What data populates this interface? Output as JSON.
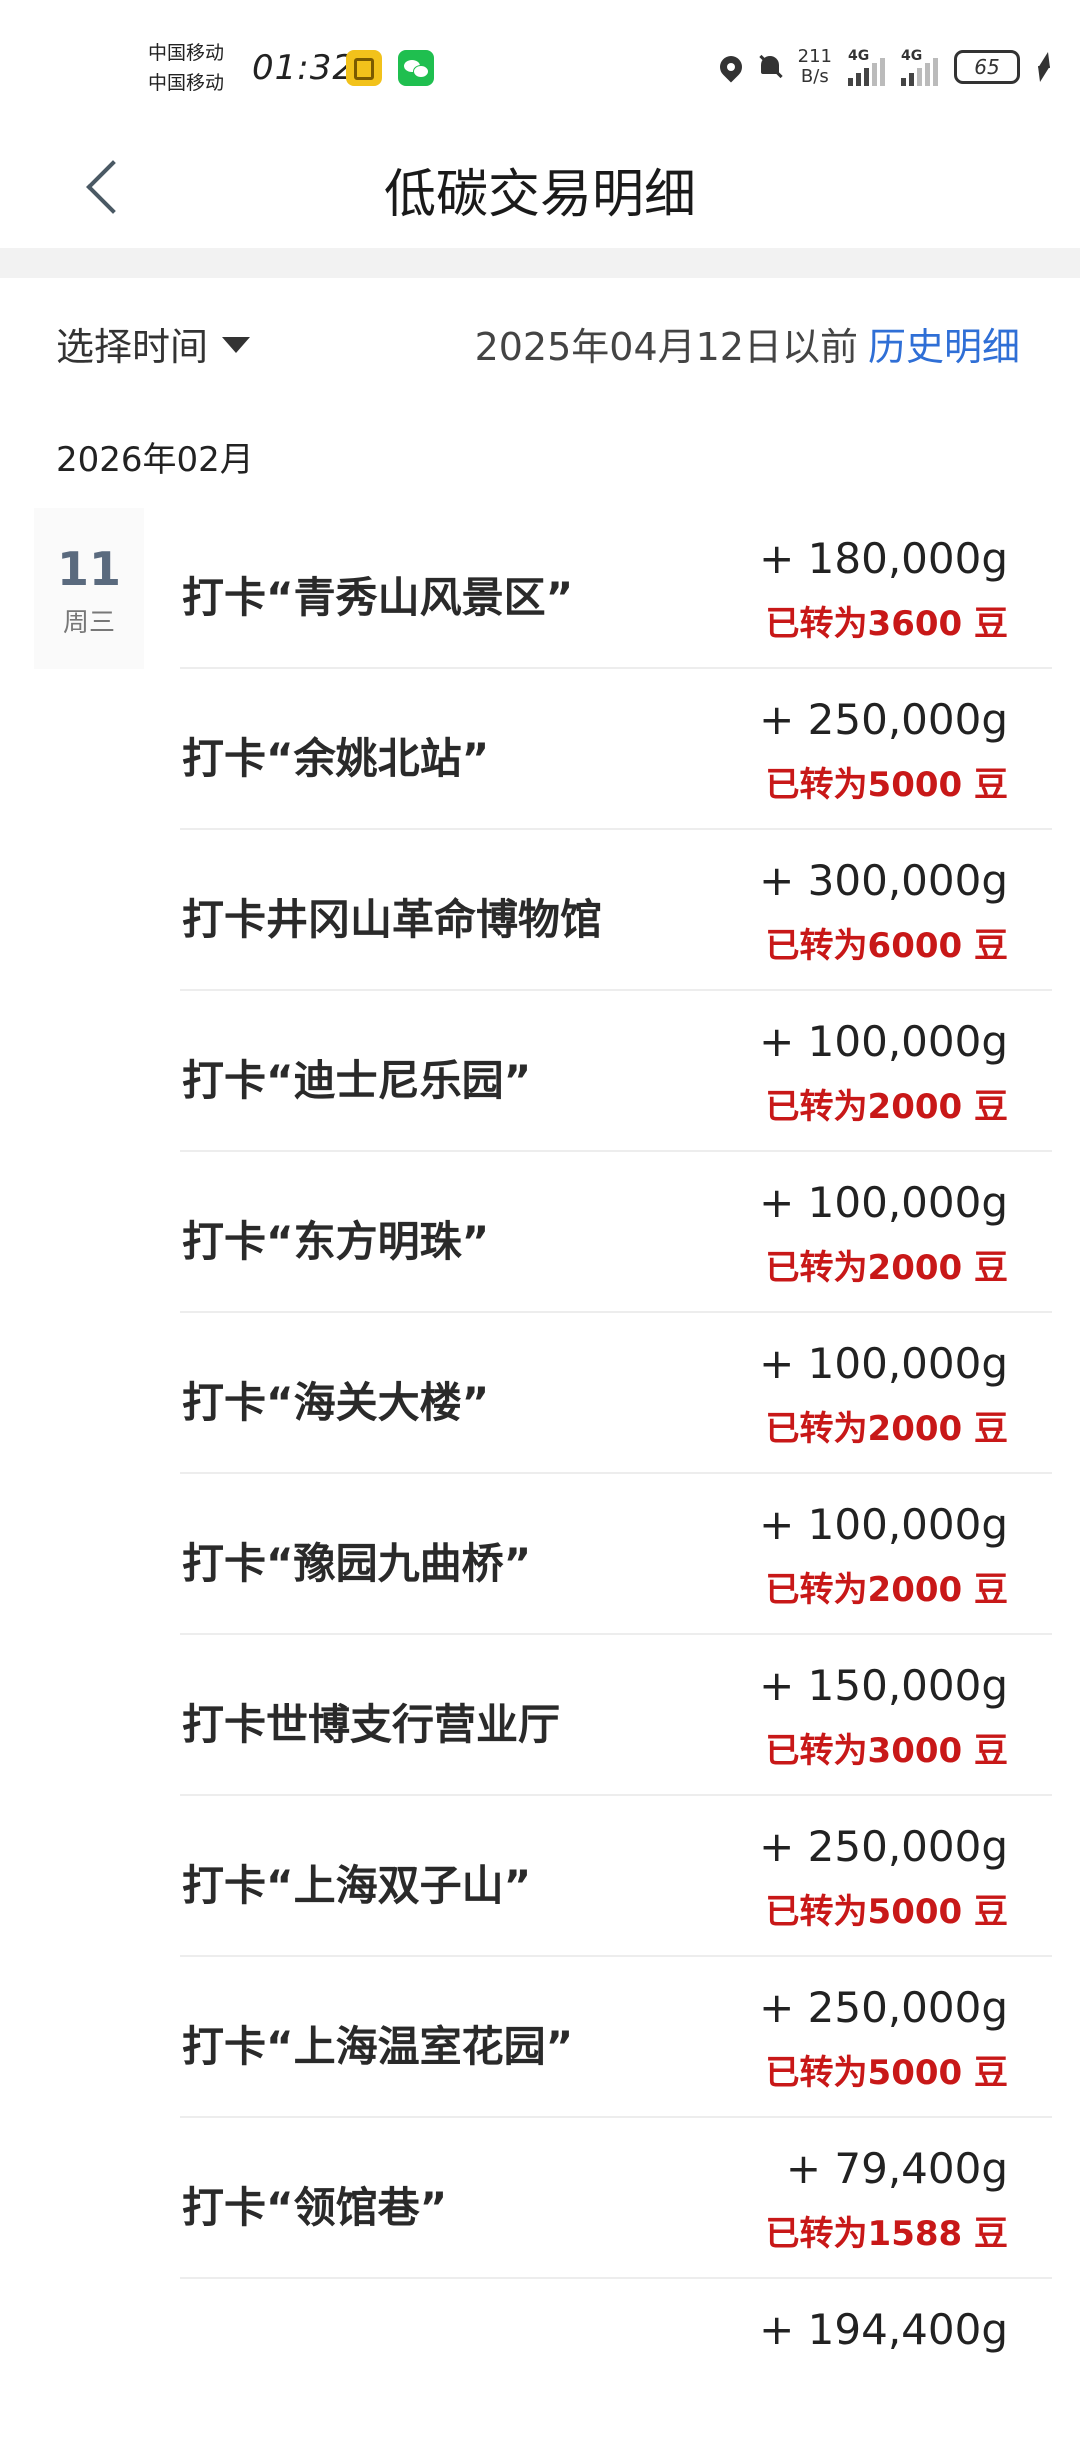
{
  "status": {
    "carrier1": "中国移动",
    "carrier2": "中国移动",
    "time": "01:32",
    "netspeed_value": "211",
    "netspeed_unit": "B/s",
    "sig1_label": "4G",
    "sig2_label": "4G",
    "battery": "65"
  },
  "header": {
    "title": "低碳交易明细"
  },
  "filter": {
    "select_time_label": "选择时间",
    "before_text": "2025年04月12日以前",
    "history_link": "历史明细"
  },
  "month": "2026年02月",
  "date": {
    "day": "11",
    "weekday": "周三"
  },
  "transactions": [
    {
      "title": "打卡“青秀山风景区”",
      "amount": "+ 180,000g",
      "note": "已转为3600 豆"
    },
    {
      "title": "打卡“余姚北站”",
      "amount": "+ 250,000g",
      "note": "已转为5000 豆"
    },
    {
      "title": "打卡井冈山革命博物馆",
      "amount": "+ 300,000g",
      "note": "已转为6000 豆"
    },
    {
      "title": "打卡“迪士尼乐园”",
      "amount": "+ 100,000g",
      "note": "已转为2000 豆"
    },
    {
      "title": "打卡“东方明珠”",
      "amount": "+ 100,000g",
      "note": "已转为2000 豆"
    },
    {
      "title": "打卡“海关大楼”",
      "amount": "+ 100,000g",
      "note": "已转为2000 豆"
    },
    {
      "title": "打卡“豫园九曲桥”",
      "amount": "+ 100,000g",
      "note": "已转为2000 豆"
    },
    {
      "title": "打卡世博支行营业厅",
      "amount": "+ 150,000g",
      "note": "已转为3000 豆"
    },
    {
      "title": "打卡“上海双子山”",
      "amount": "+ 250,000g",
      "note": "已转为5000 豆"
    },
    {
      "title": "打卡“上海温室花园”",
      "amount": "+ 250,000g",
      "note": "已转为5000 豆"
    },
    {
      "title": "打卡“领馆巷”",
      "amount": "+ 79,400g",
      "note": "已转为1588 豆"
    },
    {
      "title": "",
      "amount": "+ 194,400g",
      "note": ""
    }
  ]
}
